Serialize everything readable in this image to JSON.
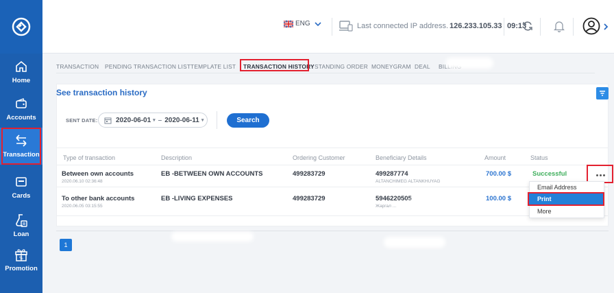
{
  "sidebar": {
    "items": [
      {
        "label": "Home",
        "icon": "home-icon"
      },
      {
        "label": "Accounts",
        "icon": "wallet-icon"
      },
      {
        "label": "Transaction",
        "icon": "transfer-arrows-icon"
      },
      {
        "label": "Cards",
        "icon": "card-icon"
      },
      {
        "label": "Loan",
        "icon": "loan-icon"
      },
      {
        "label": "Promotion",
        "icon": "gift-icon"
      }
    ]
  },
  "topbar": {
    "language": "ENG",
    "ip_label": "Last connected IP address.",
    "ip_value": "126.233.105.33",
    "time": "09:13"
  },
  "tabs": [
    "TRANSACTION",
    "PENDING TRANSACTION LIST",
    "TEMPLATE LIST",
    "TRANSACTION HISTORY",
    "STANDING ORDER",
    "MONEYGRAM",
    "DEAL",
    "BILLING"
  ],
  "section_title": "See transaction history",
  "filter": {
    "label": "SENT DATE:",
    "date_from": "2020-06-01",
    "date_to": "2020-06-11",
    "search_label": "Search"
  },
  "table": {
    "headers": [
      "Type of transaction",
      "Description",
      "Ordering Customer",
      "Beneficiary Details",
      "Amount",
      "Status"
    ],
    "rows": [
      {
        "type": "Between own accounts",
        "timestamp": "2020.06.10 02:36:48",
        "description": "EB -BETWEEN OWN ACCOUNTS",
        "customer": "499283729",
        "beneficiary": "499287774",
        "beneficiary_name": "ALTANCHIMEG ALTANKHUYAG",
        "amount": "700.00 $",
        "status": "Successful"
      },
      {
        "type": "To other bank accounts",
        "timestamp": "2020.06.05 03:15:55",
        "description": "EB -LIVING EXPENSES",
        "customer": "499283729",
        "beneficiary": "5946220505",
        "beneficiary_name": "Жаргал ...",
        "amount": "100.00 $",
        "status": ""
      }
    ]
  },
  "menu": [
    "Email Address",
    "Print",
    "More"
  ],
  "pagination": {
    "current": "1"
  },
  "colors": {
    "sidebar": "#1c5fb0",
    "accent": "#1f6fd1",
    "highlight": "#e3202f",
    "success": "#3eae5b"
  }
}
